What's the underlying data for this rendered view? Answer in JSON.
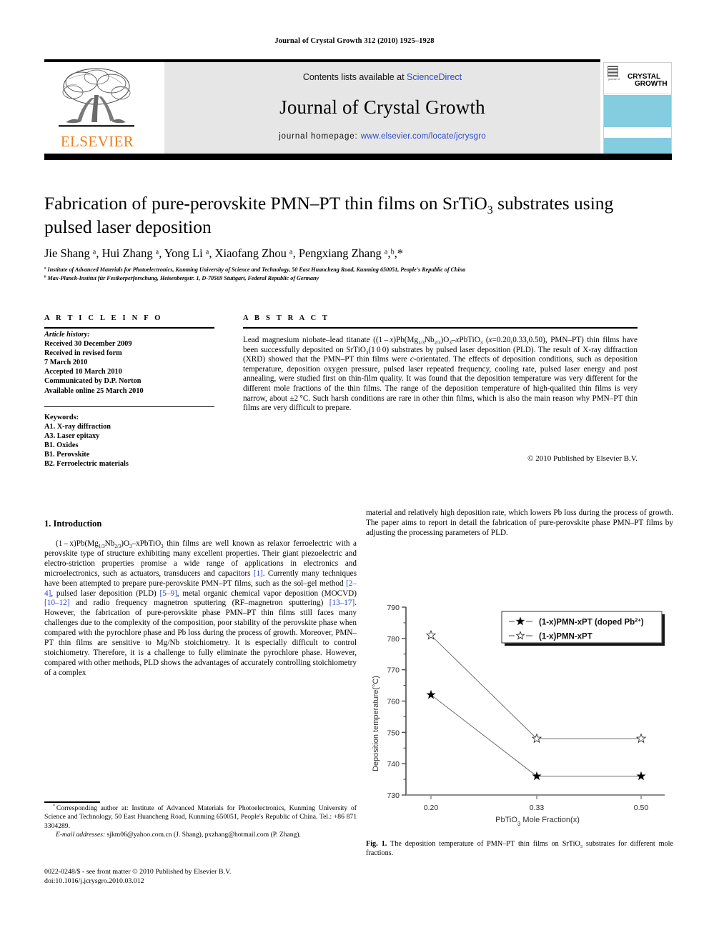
{
  "running_head": "Journal of Crystal Growth 312 (2010) 1925–1928",
  "masthead": {
    "contents_prefix": "Contents lists available at ",
    "sciencedirect": "ScienceDirect",
    "journal_title": "Journal of Crystal Growth",
    "homepage_prefix": "journal homepage: ",
    "homepage_url": "www.elsevier.com/locate/jcrysgro",
    "publisher": "ELSEVIER",
    "publisher_color": "#ef7d1a",
    "link_color": "#2b49c8",
    "cover_pretext": "journal of",
    "cover_line1": "CRYSTAL",
    "cover_line2": "GROWTH",
    "cover_color": "#84ccdf"
  },
  "article": {
    "title_line1": "Fabrication of pure-perovskite PMN–PT thin films on SrTiO",
    "title_sub1": "3",
    "title_line1b": " substrates using",
    "title_line2": "pulsed laser deposition",
    "authors": "Jie Shang ᵃ, Hui Zhang ᵃ, Yong Li ᵃ, Xiaofang Zhou ᵃ, Pengxiang Zhang ᵃ,ᵇ,*",
    "affiliation_a": "Institute of Advanced Materials for Photoelectronics, Kunming University of Science and Technology, 50 East Huancheng Road, Kunming 650051, People's Republic of China",
    "affiliation_b": "Max-Planck-Institut für Festkorperforschung, Heisenbergstr. 1, D-70569 Stuttgart, Federal Republic of Germany"
  },
  "info": {
    "heading": "A R T I C L E   I N F O",
    "history_label": "Article history:",
    "history": [
      "Received 30 December 2009",
      "Received in revised form",
      "7 March 2010",
      "Accepted 10 March 2010",
      "Communicated by D.P. Norton",
      "Available online 25 March 2010"
    ],
    "keywords_label": "Keywords:",
    "keywords": [
      "A1. X-ray diffraction",
      "A3. Laser epitaxy",
      "B1. Oxides",
      "B1. Perovskite",
      "B2. Ferroelectric materials"
    ]
  },
  "abstract": {
    "heading": "A B S T R A C T",
    "copyright": "© 2010 Published by Elsevier B.V."
  },
  "body": {
    "section1_heading": "1. Introduction",
    "right_col_top": "material and relatively high deposition rate, which lowers Pb loss during the process of growth. The paper aims to report in detail the fabrication of pure-perovskite phase PMN–PT films by adjusting the processing parameters of PLD."
  },
  "footnote": {
    "corresponding": "Corresponding author at: Institute of Advanced Materials for Photoelectronics, Kunming University of Science and Technology, 50 East Huancheng Road, Kunming 650051, People's Republic of China. Tel.: +86 871 3304289.",
    "email_label": "E-mail addresses:",
    "emails": "sjkm06@yahoo.com.cn (J. Shang), pxzhang@hotmail.com (P. Zhang).",
    "issn_line": "0022-0248/$ - see front matter © 2010 Published by Elsevier B.V.",
    "doi_line": "doi:10.1016/j.jcrysgro.2010.03.012"
  },
  "figure": {
    "caption_label": "Fig. 1.",
    "caption_text_a": " The deposition temperature of PMN–PT thin films on SrTiO",
    "caption_sub": "3",
    "caption_text_b": " substrates for different mole fractions."
  },
  "chart_data": {
    "type": "line",
    "title": "",
    "xlabel": "PbTiO3 Mole Fraction(x)",
    "xlabel_main": "PbTiO",
    "xlabel_sub": "3",
    "xlabel_tail": " Mole Fraction(x)",
    "ylabel": "Deposition temperature(°C)",
    "ylabel_main": "Deposition temperature(",
    "ylabel_unit": "°C",
    "ylabel_tail": ")",
    "x": [
      0.2,
      0.33,
      0.5
    ],
    "categories": [
      "0.20",
      "0.33",
      "0.50"
    ],
    "xticklabels": [
      "0.20",
      "0.33",
      "0.50"
    ],
    "yticklabels": [
      "730",
      "740",
      "750",
      "760",
      "770",
      "780",
      "790"
    ],
    "yticks": [
      730,
      740,
      750,
      760,
      770,
      780,
      790
    ],
    "ylim": [
      730,
      790
    ],
    "grid": false,
    "legend_position": "top-right",
    "series": [
      {
        "name": "(1-x)PMN-xPT (doped Pb2+)",
        "legend_main": "(1-x)PMN-xPT (doped Pb",
        "legend_sup": "2+",
        "legend_tail": ")",
        "marker": "filled-star",
        "values": [
          762,
          736,
          736
        ]
      },
      {
        "name": "(1-x)PMN-xPT",
        "legend_main": "(1-x)PMN-xPT",
        "legend_sup": "",
        "legend_tail": "",
        "marker": "open-star",
        "values": [
          781,
          748,
          748
        ]
      }
    ]
  }
}
